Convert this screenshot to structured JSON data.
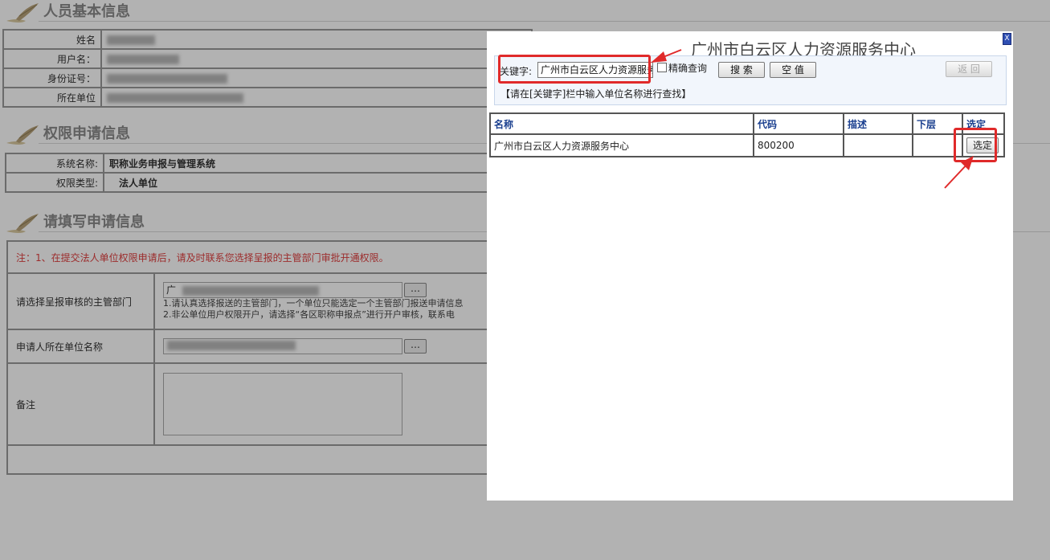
{
  "sections": {
    "basic": "人员基本信息",
    "permission": "权限申请信息",
    "apply": "请填写申请信息"
  },
  "basic_info": {
    "name_label": "姓名",
    "username_label": "用户名：",
    "id_label": "身份证号：",
    "unit_label": "所在单位"
  },
  "permission_info": {
    "system_label": "系统名称:",
    "system_value": "职称业务申报与管理系统",
    "type_label": "权限类型:",
    "type_value": "法人单位"
  },
  "apply_form": {
    "note": "注：1、在提交法人单位权限申请后，请及时联系您选择呈报的主管部门审批开通权限。",
    "dept_label": "请选择呈报审核的主管部门",
    "dept_value": "广",
    "dept_hint1": "1.请认真选择报送的主管部门，一个单位只能选定一个主管部门报送申请信息",
    "dept_hint2": "2.非公单位用户权限开户，请选择“各区职称申报点”进行开户审核，联系电",
    "unit_label": "申请人所在单位名称",
    "remark_label": "备注",
    "dots": "…"
  },
  "dialog": {
    "close": "X",
    "heading": "广州市白云区人力资源服务中心",
    "keyword_label": "关键字:",
    "keyword_value": "广州市白云区人力资源服务中心",
    "exact_label": "精确查询",
    "search_button": "搜 索",
    "clear_button": "空 值",
    "back_button": "返 回",
    "tip": "【请在[关键字]栏中输入单位名称进行查找】",
    "columns": [
      "名称",
      "代码",
      "描述",
      "下层",
      "选定"
    ],
    "rows": [
      {
        "name": "广州市白云区人力资源服务中心",
        "code": "800200",
        "desc": "",
        "sub": "",
        "select": "选定"
      }
    ]
  },
  "colors": {
    "annotation_red": "#e02a2a",
    "header_blue": "#1a3f8f"
  }
}
